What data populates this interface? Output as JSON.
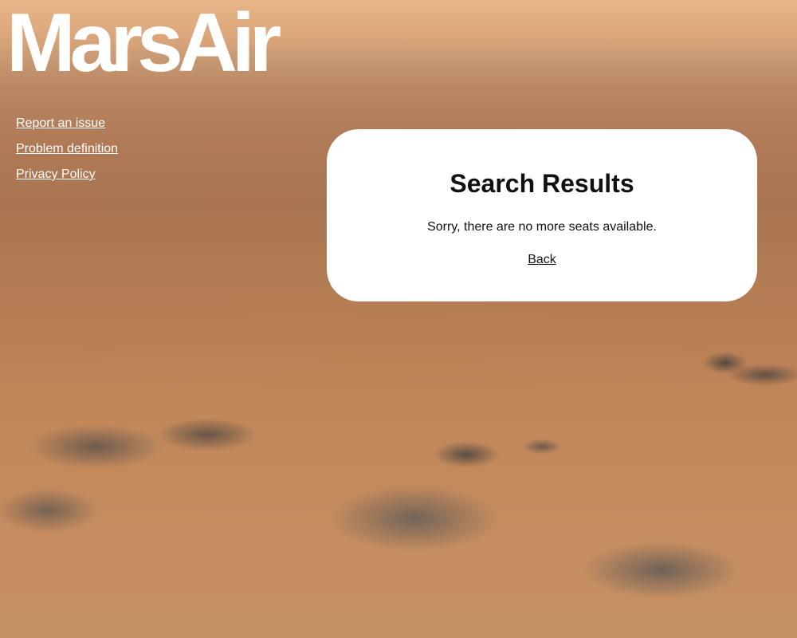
{
  "brand": {
    "logo_text": "MarsAir"
  },
  "nav": {
    "items": [
      {
        "label": "Report an issue"
      },
      {
        "label": "Problem definition"
      },
      {
        "label": "Privacy Policy"
      }
    ]
  },
  "results": {
    "title": "Search Results",
    "message": "Sorry, there are no more seats available.",
    "back_label": "Back"
  },
  "colors": {
    "link_nav": "#ffffff",
    "panel_bg": "#ffffff",
    "text": "#111111"
  }
}
